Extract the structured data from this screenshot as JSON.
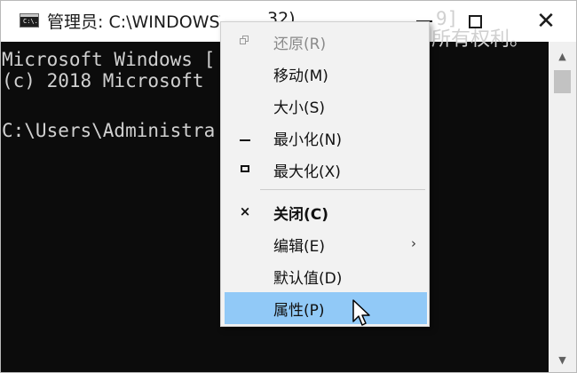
{
  "titlebar": {
    "icon_text": "C:\\.",
    "title": "管理员: C:\\WINDOWS\\system32\\cmd.exe",
    "title_tail": "32)",
    "min_icon": "minimize-icon",
    "max_icon": "maximize-icon",
    "close_icon": "close-icon"
  },
  "console": {
    "line1": "Microsoft Windows [",
    "line1_tail": "9]",
    "line2": "(c) 2018 Microsoft",
    "line2_tail": "所有权利。",
    "line3": "C:\\Users\\Administra"
  },
  "menu": {
    "items": [
      {
        "label": "还原(R)",
        "icon": "restore-icon",
        "state": "disabled"
      },
      {
        "label": "移动(M)",
        "icon": "",
        "state": "normal"
      },
      {
        "label": "大小(S)",
        "icon": "",
        "state": "normal"
      },
      {
        "label": "最小化(N)",
        "icon": "minimize-icon",
        "state": "normal"
      },
      {
        "label": "最大化(X)",
        "icon": "maximize-icon",
        "state": "normal"
      },
      {
        "label": "关闭(C)",
        "icon": "close-icon",
        "state": "bold"
      },
      {
        "label": "编辑(E)",
        "icon": "",
        "state": "submenu"
      },
      {
        "label": "默认值(D)",
        "icon": "",
        "state": "normal"
      },
      {
        "label": "属性(P)",
        "icon": "",
        "state": "highlighted"
      }
    ],
    "highlight_color": "#91c9f7"
  },
  "colors": {
    "console_bg": "#0c0c0c",
    "console_text": "#d0d0d0",
    "menu_bg": "#f2f2f2"
  }
}
